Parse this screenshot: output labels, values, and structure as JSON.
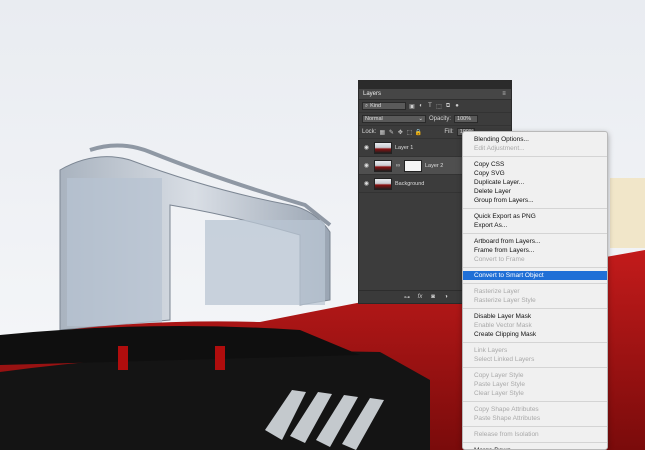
{
  "layers_panel": {
    "title": "Layers",
    "filter_kind": "Kind",
    "blend_mode": "Normal",
    "opacity_label": "Opacity:",
    "opacity_value": "100%",
    "lock_label": "Lock:",
    "fill_label": "Fill:",
    "fill_value": "100%",
    "layers": [
      {
        "name": "Layer 1",
        "selected": false
      },
      {
        "name": "Layer 2",
        "selected": true
      },
      {
        "name": "Background",
        "selected": false
      }
    ],
    "footer_icons": [
      "link-icon",
      "fx-icon",
      "mask-icon",
      "adjustment-icon",
      "folder-icon",
      "new-layer-icon",
      "trash-icon"
    ]
  },
  "context_menu": {
    "items": [
      {
        "label": "Blending Options...",
        "enabled": true
      },
      {
        "label": "Edit Adjustment...",
        "enabled": false
      },
      {
        "sep": true
      },
      {
        "label": "Copy CSS",
        "enabled": true
      },
      {
        "label": "Copy SVG",
        "enabled": true
      },
      {
        "label": "Duplicate Layer...",
        "enabled": true
      },
      {
        "label": "Delete Layer",
        "enabled": true
      },
      {
        "label": "Group from Layers...",
        "enabled": true
      },
      {
        "sep": true
      },
      {
        "label": "Quick Export as PNG",
        "enabled": true
      },
      {
        "label": "Export As...",
        "enabled": true
      },
      {
        "sep": true
      },
      {
        "label": "Artboard from Layers...",
        "enabled": true
      },
      {
        "label": "Frame from Layers...",
        "enabled": true
      },
      {
        "label": "Convert to Frame",
        "enabled": false
      },
      {
        "sep": true
      },
      {
        "label": "Convert to Smart Object",
        "enabled": true,
        "highlighted": true
      },
      {
        "sep": true
      },
      {
        "label": "Rasterize Layer",
        "enabled": false
      },
      {
        "label": "Rasterize Layer Style",
        "enabled": false
      },
      {
        "sep": true
      },
      {
        "label": "Disable Layer Mask",
        "enabled": true
      },
      {
        "label": "Enable Vector Mask",
        "enabled": false
      },
      {
        "label": "Create Clipping Mask",
        "enabled": true
      },
      {
        "sep": true
      },
      {
        "label": "Link Layers",
        "enabled": false
      },
      {
        "label": "Select Linked Layers",
        "enabled": false
      },
      {
        "sep": true
      },
      {
        "label": "Copy Layer Style",
        "enabled": false
      },
      {
        "label": "Paste Layer Style",
        "enabled": false
      },
      {
        "label": "Clear Layer Style",
        "enabled": false
      },
      {
        "sep": true
      },
      {
        "label": "Copy Shape Attributes",
        "enabled": false
      },
      {
        "label": "Paste Shape Attributes",
        "enabled": false
      },
      {
        "sep": true
      },
      {
        "label": "Release from Isolation",
        "enabled": false
      },
      {
        "sep": true
      },
      {
        "label": "Merge Down",
        "enabled": true
      }
    ]
  }
}
